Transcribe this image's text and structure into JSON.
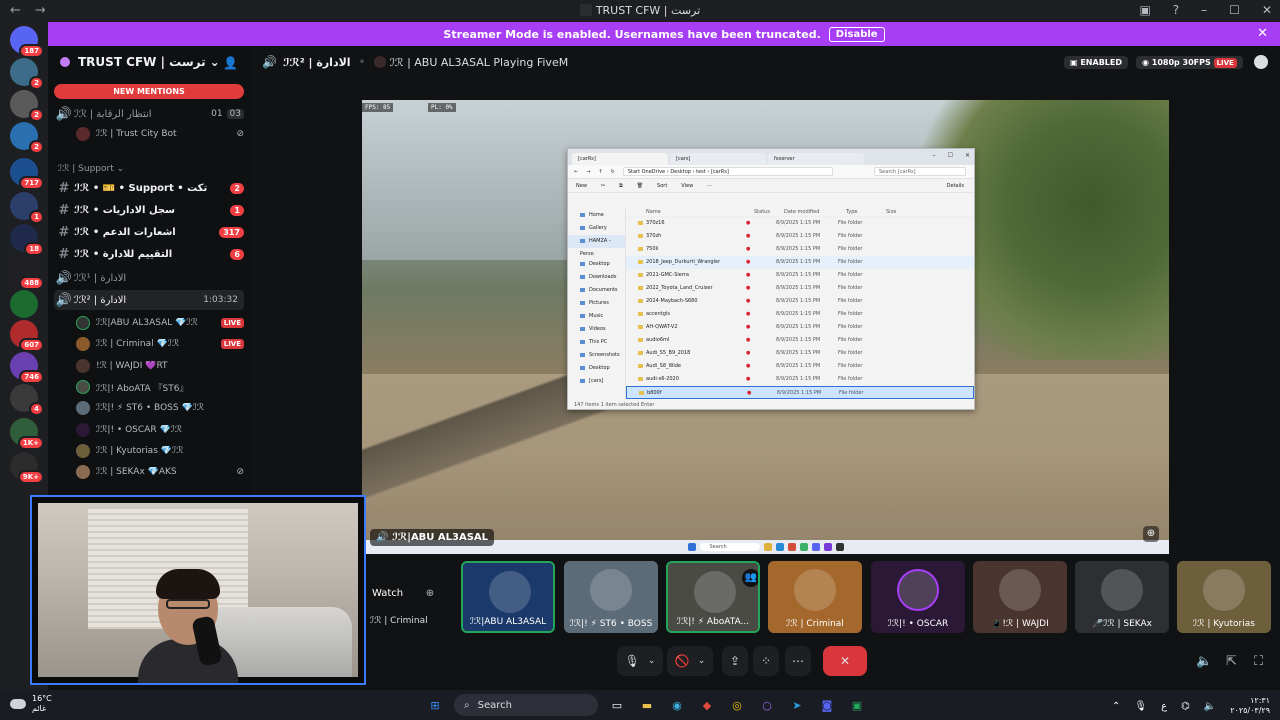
{
  "window": {
    "title": "TRUST CFW | ترست"
  },
  "banner": {
    "text": "Streamer Mode is enabled. Usernames have been truncated.",
    "button": "Disable"
  },
  "rail": {
    "badges": [
      "187",
      "2",
      "2",
      "2",
      "717",
      "1",
      "18",
      "488",
      "607",
      "746",
      "4",
      "1K+",
      "9K+"
    ]
  },
  "sidebar": {
    "guild_name": "TRUST CFW | ترست",
    "new_mentions": "NEW MENTIONS",
    "top_channel": {
      "name": "ℐℛ | انتظار الرقابة",
      "count_a": "01",
      "count_b": "03"
    },
    "top_channel_user": "ℐℛ | Trust City Bot",
    "category": "ℐℛ | Support",
    "channels": [
      {
        "name": "ℐℛ • 🎫 • Support • تكت",
        "badge": "2"
      },
      {
        "name": "ℐℛ • سجل الاداريات",
        "badge": "1"
      },
      {
        "name": "ℐℛ • اشعارات الدعم",
        "badge": "317"
      },
      {
        "name": "ℐℛ • التقييم للادارة",
        "badge": "6"
      }
    ],
    "voice_inactive": "ℐℛ¹ | الادارة",
    "voice_active": {
      "name": "ℐℛ² | الادارة",
      "time": "1:03:32"
    },
    "voice_users": [
      {
        "name": "ℐℛ|ABU AL3ASAL",
        "tag": "💎ℐℛ",
        "live": "LIVE"
      },
      {
        "name": "ℐℛ | Criminal",
        "tag": "💎ℐℛ",
        "live": "LIVE"
      },
      {
        "name": "!ℛ | WAJDI",
        "tag": "💜RT",
        "live": ""
      },
      {
        "name": "ℐℛ|! AboATA 『ST6』",
        "tag": "",
        "live": ""
      },
      {
        "name": "ℐℛ|! ⚡ ST6 • BOSS",
        "tag": "💎ℐℛ",
        "live": ""
      },
      {
        "name": "ℐℛ|! • OSCAR",
        "tag": "💎ℐℛ",
        "live": ""
      },
      {
        "name": "ℐℛ | Kyutorias",
        "tag": "💎ℐℛ",
        "live": ""
      },
      {
        "name": "ℐℛ | SEKAx",
        "tag": "💎AKS",
        "live": ""
      }
    ]
  },
  "stage": {
    "channel": "ℐℛ² | الادارة",
    "activity": "ℐℛ | ABU AL3ASAL Playing FiveM",
    "enabled_pill": "ENABLED",
    "quality": "1080p 30FPS",
    "live": "LIVE",
    "fps_label": "FPS: 85",
    "pl_label": "PL: 0%",
    "streamer_card": "ℐℛ|ABU AL3ASAL",
    "win_search": "Search"
  },
  "explorer": {
    "tabs": [
      "[carRs]",
      "[cars]",
      "fxserver"
    ],
    "breadcrumb": [
      "Start OneDrive",
      "Desktop",
      "test",
      "[carRs]"
    ],
    "search_placeholder": "Search [carRs]",
    "toolbar": [
      "New",
      "Sort",
      "View",
      "Details"
    ],
    "nav": [
      "Home",
      "Gallery",
      "HAMZA - Perso",
      "Desktop",
      "Downloads",
      "Documents",
      "Pictures",
      "Music",
      "Videos",
      "This PC",
      "Screenshots",
      "Desktop",
      "[cars]"
    ],
    "columns": [
      "Name",
      "Status",
      "Date modified",
      "Type",
      "Size"
    ],
    "files": [
      {
        "name": "370z16",
        "date": "8/9/2025 1:15 PM",
        "type": "File folder"
      },
      {
        "name": "370zh",
        "date": "8/9/2025 1:15 PM",
        "type": "File folder"
      },
      {
        "name": "750li",
        "date": "8/9/2025 1:15 PM",
        "type": "File folder"
      },
      {
        "name": "2018_Jeep_Durkurti_Wrangler",
        "date": "8/9/2025 1:15 PM",
        "type": "File folder"
      },
      {
        "name": "2021-GMC-Sierra",
        "date": "8/9/2025 1:15 PM",
        "type": "File folder"
      },
      {
        "name": "2022_Toyota_Land_Cruiser",
        "date": "8/9/2025 1:15 PM",
        "type": "File folder"
      },
      {
        "name": "2024-Maybach-S680",
        "date": "8/9/2025 1:15 PM",
        "type": "File folder"
      },
      {
        "name": "accentgls",
        "date": "8/9/2025 1:15 PM",
        "type": "File folder"
      },
      {
        "name": "AH-QWAT-V2",
        "date": "8/9/2025 1:15 PM",
        "type": "File folder"
      },
      {
        "name": "audio6ml",
        "date": "8/9/2025 1:15 PM",
        "type": "File folder"
      },
      {
        "name": "Audi_S5_B9_2018",
        "date": "8/9/2025 1:15 PM",
        "type": "File folder"
      },
      {
        "name": "Audi_S8_Wide",
        "date": "8/9/2025 1:15 PM",
        "type": "File folder"
      },
      {
        "name": "audi-s6-2020",
        "date": "8/9/2025 1:15 PM",
        "type": "File folder"
      },
      {
        "name": "b800f",
        "date": "8/9/2025 1:15 PM",
        "type": "File folder"
      }
    ],
    "status": "147 items   1 item selected   Enter"
  },
  "participants": {
    "watch": "Watch",
    "partial_label": "ℐℛ | Criminal",
    "tiles": [
      {
        "name": "ℐℛ|ABU AL3ASAL",
        "color": "#1b3a6b",
        "speaking": true
      },
      {
        "name": "ℐℛ|! ⚡ ST6 • BOSS",
        "color": "#5c6b78",
        "speaking": false
      },
      {
        "name": "ℐℛ|! ⚡ AboATA...",
        "color": "#4a4b45",
        "speaking": true
      },
      {
        "name": "ℐℛ | Criminal",
        "color": "#a4682d",
        "speaking": false
      },
      {
        "name": "ℐℛ|! • OSCAR",
        "color": "#2a1836",
        "speaking": false
      },
      {
        "name": "📱!ℛ | WAJDI",
        "color": "#4a3430",
        "speaking": false
      },
      {
        "name": "🎤ℐℛ | SEKAx",
        "color": "#2d2f33",
        "speaking": false
      },
      {
        "name": "ℐℛ | Kyutorias",
        "color": "#6e5f3c",
        "speaking": false
      }
    ]
  },
  "taskbar": {
    "temp": "16°C",
    "weather": "غائم",
    "search": "Search",
    "lang": "ع",
    "time": "١٢:٣١",
    "date": "٢٠٢٥/٠٣/٢٩"
  }
}
